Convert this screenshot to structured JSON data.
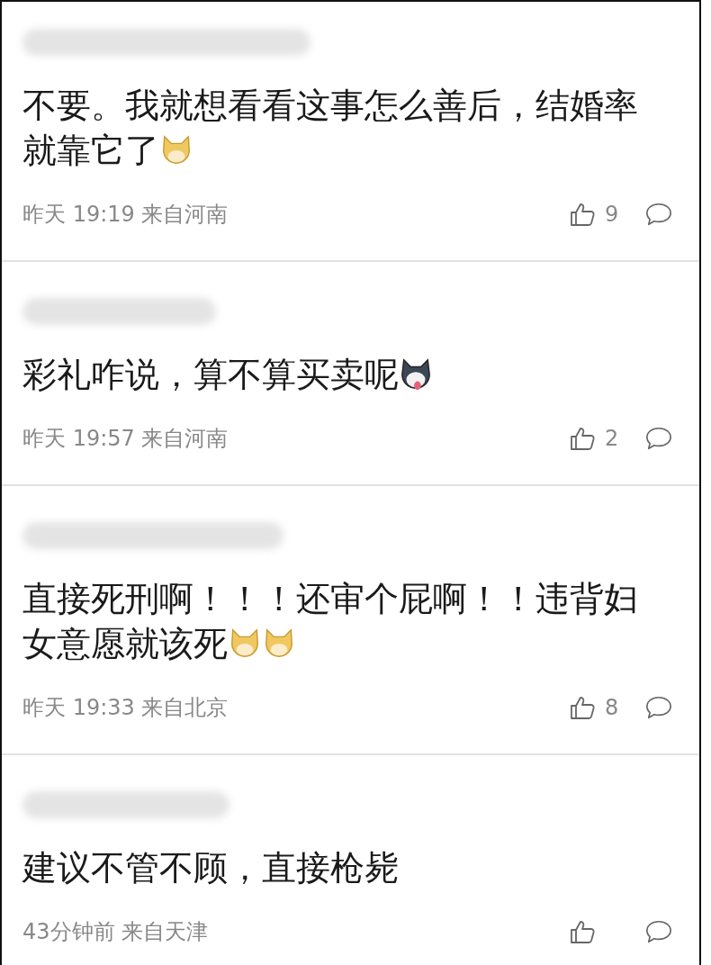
{
  "comments": [
    {
      "text": "不要。我就想看看这事怎么善后，结婚率就靠它了",
      "emojis": [
        {
          "kind": "doge"
        }
      ],
      "meta": "昨天 19:19 来自河南",
      "likes": "9"
    },
    {
      "text": "彩礼咋说，算不算买卖呢",
      "emojis": [
        {
          "kind": "husky"
        }
      ],
      "meta": "昨天 19:57 来自河南",
      "likes": "2"
    },
    {
      "text": "直接死刑啊！！！还审个屁啊！！违背妇女意愿就该死",
      "emojis": [
        {
          "kind": "doge"
        },
        {
          "kind": "doge"
        }
      ],
      "meta": "昨天 19:33 来自北京",
      "likes": "8"
    },
    {
      "text": "建议不管不顾，直接枪毙",
      "meta": "43分钟前 来自天津"
    }
  ]
}
